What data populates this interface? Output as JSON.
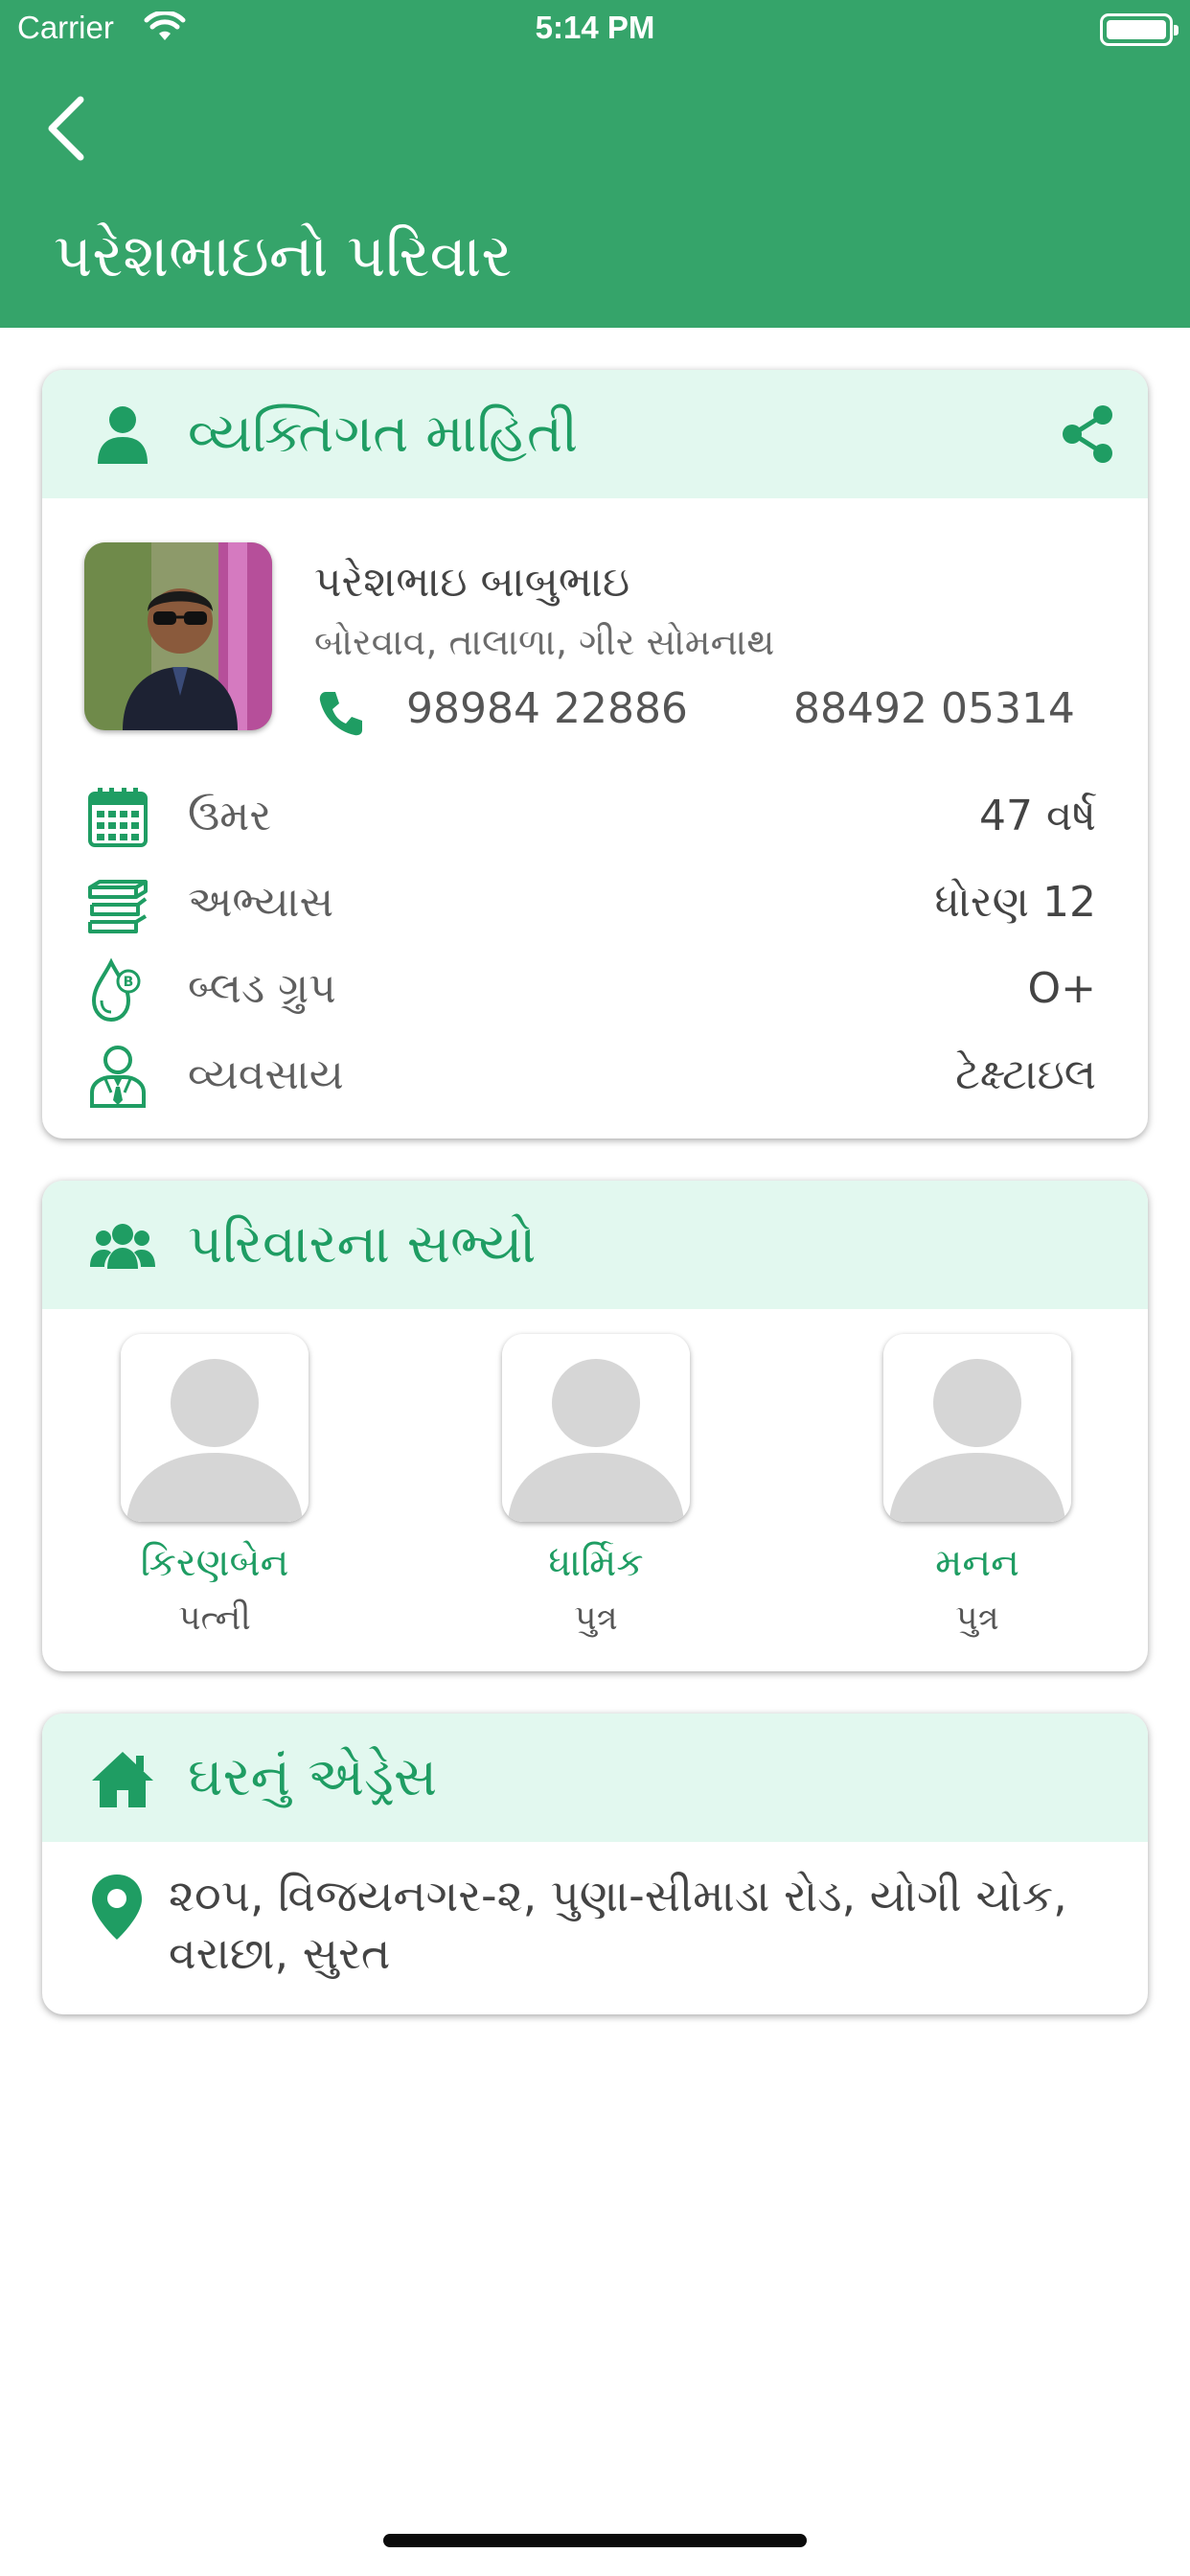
{
  "status_bar": {
    "carrier": "Carrier",
    "time": "5:14 PM"
  },
  "header": {
    "title": "પરેશભાઇનો પરિવાર",
    "back_icon": "chevron-left-icon"
  },
  "colors": {
    "primary": "#35a46a",
    "accent": "#1f9d63",
    "card_header_bg": "#e2f8ef"
  },
  "personal": {
    "title": "વ્યક્તિગત માહિતી",
    "name": "પરેશભાઇ બાબુભાઇ",
    "location": "બોરવાવ, તાલાળા, ગીર સોમનાથ",
    "phone1": "98984 22886",
    "phone2": "88492 05314",
    "rows": [
      {
        "icon": "calendar-icon",
        "label": "ઉમર",
        "value": "47 વર્ષ"
      },
      {
        "icon": "books-icon",
        "label": "અભ્યાસ",
        "value": "ધોરણ 12"
      },
      {
        "icon": "blood-drop-icon",
        "label": "બ્લડ ગ્રુપ",
        "value": "O+"
      },
      {
        "icon": "person-tie-icon",
        "label": "વ્યવસાય",
        "value": "ટેક્ષ્ટાઇલ"
      }
    ]
  },
  "family": {
    "title": "પરિવારના સભ્યો",
    "members": [
      {
        "name": "કિરણબેન",
        "relation": "પત્ની"
      },
      {
        "name": "ધાર્મિક",
        "relation": "પુત્ર"
      },
      {
        "name": "મનન",
        "relation": "પુત્ર"
      }
    ]
  },
  "address": {
    "title": "ઘરનું એડ્રેસ",
    "text": "૨૦૫, વિજયનગર-૨, પુણા-સીમાડા રોડ, યોગી ચોક, વરાછા, સુરત"
  }
}
